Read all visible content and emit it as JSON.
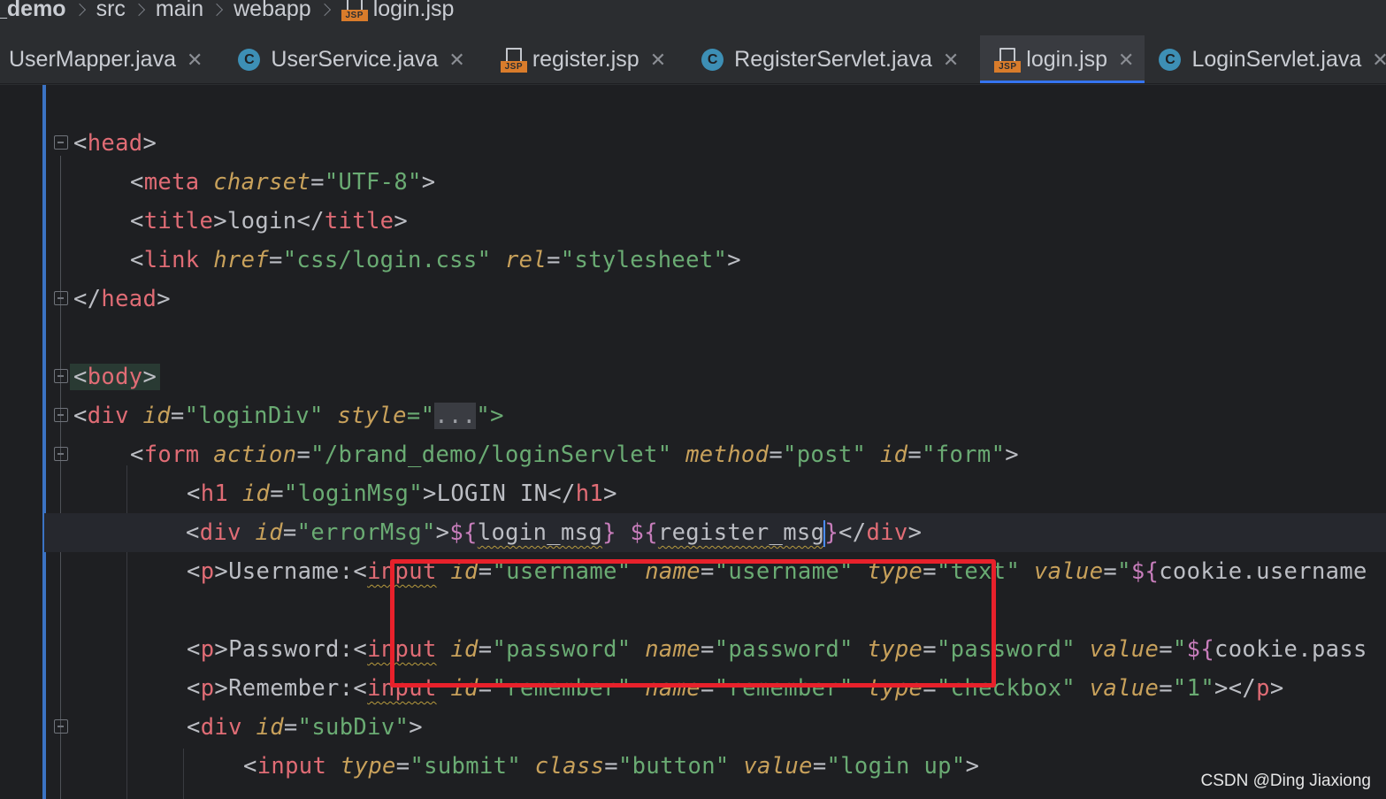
{
  "breadcrumb": {
    "items": [
      "_demo",
      "src",
      "main",
      "webapp",
      "login.jsp"
    ]
  },
  "tabs": [
    {
      "label": "UserMapper.java",
      "icon": "none",
      "active": false
    },
    {
      "label": "UserService.java",
      "icon": "java-class-icon",
      "active": false
    },
    {
      "label": "register.jsp",
      "icon": "jsp-icon",
      "active": false
    },
    {
      "label": "RegisterServlet.java",
      "icon": "java-class-icon",
      "active": false
    },
    {
      "label": "login.jsp",
      "icon": "jsp-icon",
      "active": true
    },
    {
      "label": "LoginServlet.java",
      "icon": "java-class-icon",
      "active": false
    }
  ],
  "icons": {
    "jsp_badge": "JSP",
    "class_letter": "C",
    "close": "✕"
  },
  "code": {
    "line1": {
      "t1": "<",
      "n": "head",
      "t2": ">"
    },
    "line2": {
      "t1": "<",
      "n": "meta",
      "a1": "charset",
      "eq": "=",
      "v1": "\"UTF-8\"",
      "t2": ">"
    },
    "line3": {
      "t1": "<",
      "n": "title",
      "t2": ">",
      "text": "login",
      "t3": "</",
      "n2": "title",
      "t4": ">"
    },
    "line4": {
      "t1": "<",
      "n": "link",
      "a1": "href",
      "v1": "\"css/login.css\"",
      "a2": "rel",
      "v2": "\"stylesheet\"",
      "t2": ">"
    },
    "line5": {
      "t1": "</",
      "n": "head",
      "t2": ">"
    },
    "line6": {
      "t1": "<",
      "n": "body",
      "t2": ">"
    },
    "line7": {
      "t1": "<",
      "n": "div",
      "a1": "id",
      "v1": "\"loginDiv\"",
      "a2": "style",
      "q1": "=\"",
      "dots": "...",
      "q2": "\">"
    },
    "line8": {
      "t1": "<",
      "n": "form",
      "a1": "action",
      "v1": "\"/brand_demo/loginServlet\"",
      "a2": "method",
      "v2": "\"post\"",
      "a3": "id",
      "v3": "\"form\"",
      "t2": ">"
    },
    "line9": {
      "t1": "<",
      "n": "h1",
      "a1": "id",
      "v1": "\"loginMsg\"",
      "text": ">LOGIN IN</",
      "n2": "h1",
      "t2": ">"
    },
    "line10": {
      "t1": "<",
      "n": "div",
      "a1": "id",
      "v1": "\"errorMsg\"",
      "t2": ">",
      "el1": "${",
      "e1": "login_msg",
      "el2": "}",
      "sp": " ",
      "el3": "${",
      "e2": "register_msg",
      "el4": "}",
      "t3": "</",
      "n2": "div",
      "t4": ">"
    },
    "line11": {
      "t1": "<",
      "n": "p",
      "t2": ">Username:<",
      "n2": "input",
      "a1": "id",
      "v1": "\"username\"",
      "a2": "name",
      "v2": "\"username\"",
      "a3": "type",
      "v3": "\"text\"",
      "a4": "value",
      "v4": "\"",
      "el": "${",
      "e": "cookie.username"
    },
    "line12": {
      "t1": "<",
      "n": "p",
      "t2": ">Password:<",
      "n2": "input",
      "a1": "id",
      "v1": "\"password\"",
      "a2": "name",
      "v2": "\"password\"",
      "a3": "type",
      "v3": "\"password\"",
      "a4": "value",
      "v4": "\"",
      "el": "${",
      "e": "cookie.pass"
    },
    "line13": {
      "t1": "<",
      "n": "p",
      "t2": ">Remember:<",
      "n2": "input",
      "a1": "id",
      "v1": "\"remember\"",
      "a2": "name",
      "v2": "\"remember\"",
      "a3": "type",
      "v3": "\"checkbox\"",
      "a4": "value",
      "v4": "\"1\"",
      "t3": "></",
      "n3": "p",
      "t4": ">"
    },
    "line14": {
      "t1": "<",
      "n": "div",
      "a1": "id",
      "v1": "\"subDiv\"",
      "t2": ">"
    },
    "line15": {
      "t1": "<",
      "n": "input",
      "a1": "type",
      "v1": "\"submit\"",
      "a2": "class",
      "v2": "\"button\"",
      "a3": "value",
      "v3": "\"login up\"",
      "t2": ">"
    }
  },
  "watermark": "CSDN @Ding Jiaxiong",
  "colors": {
    "accent": "#3574f0",
    "annotation": "#e8212b",
    "tag": "#e06c75",
    "string": "#6aab73",
    "attribute": "#c8a15b",
    "el_brace": "#c77dbb"
  }
}
